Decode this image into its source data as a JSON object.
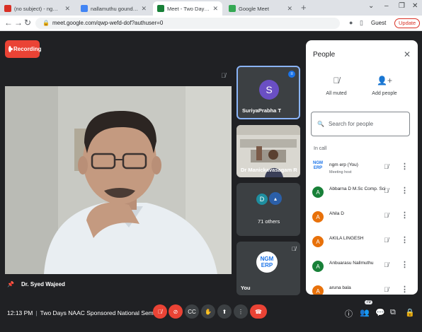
{
  "browser": {
    "tabs": [
      {
        "title": "(no subject) - ngmerp@ngmc.or",
        "favicon_color": "#d93025"
      },
      {
        "title": "nallamuthu gounder mahalingam",
        "favicon_color": "#4285f4"
      },
      {
        "title": "Meet - Two Days NAAC Spo",
        "favicon_color": "#188038"
      },
      {
        "title": "Google Meet",
        "favicon_color": "#34a853"
      }
    ],
    "url": "meet.google.com/qwp-wefd-dof?authuser=0",
    "profile_label": "Guest",
    "update_label": "Update"
  },
  "meet": {
    "recording_label": "Recording",
    "main_speaker": "Dr. Syed Wajeed",
    "tiles": [
      {
        "name": "SuriyaPrabha T",
        "initial": "S",
        "color": "#6a4fc4"
      },
      {
        "name": "Dr Manickavasagam R"
      },
      {
        "name": "71 others",
        "initial": "D",
        "color": "#1e8e9f"
      },
      {
        "name": "You",
        "logo_top": "NGM",
        "logo_bottom": "ERP"
      }
    ],
    "clock": "12:13 PM",
    "meeting_title": "Two Days NAAC Sponsored National Semi...",
    "participant_count": "79"
  },
  "people": {
    "title": "People",
    "all_muted": "All muted",
    "add_people": "Add people",
    "search_placeholder": "Search for people",
    "section": "In call",
    "participants": [
      {
        "name": "ngm erp (You)",
        "subtitle": "Meeting host",
        "logo": "NGM ERP"
      },
      {
        "name": "Abbarna D M.Sc Comp. Sci",
        "initial": "A",
        "color": "#188038"
      },
      {
        "name": "Ahila D",
        "initial": "A",
        "color": "#e8710a"
      },
      {
        "name": "AKILA LINGESH",
        "initial": "A",
        "color": "#e8710a"
      },
      {
        "name": "Anbuarasu Nallmuthu",
        "initial": "A",
        "color": "#188038"
      },
      {
        "name": "aruna bala",
        "initial": "A",
        "color": "#e8710a"
      }
    ]
  }
}
